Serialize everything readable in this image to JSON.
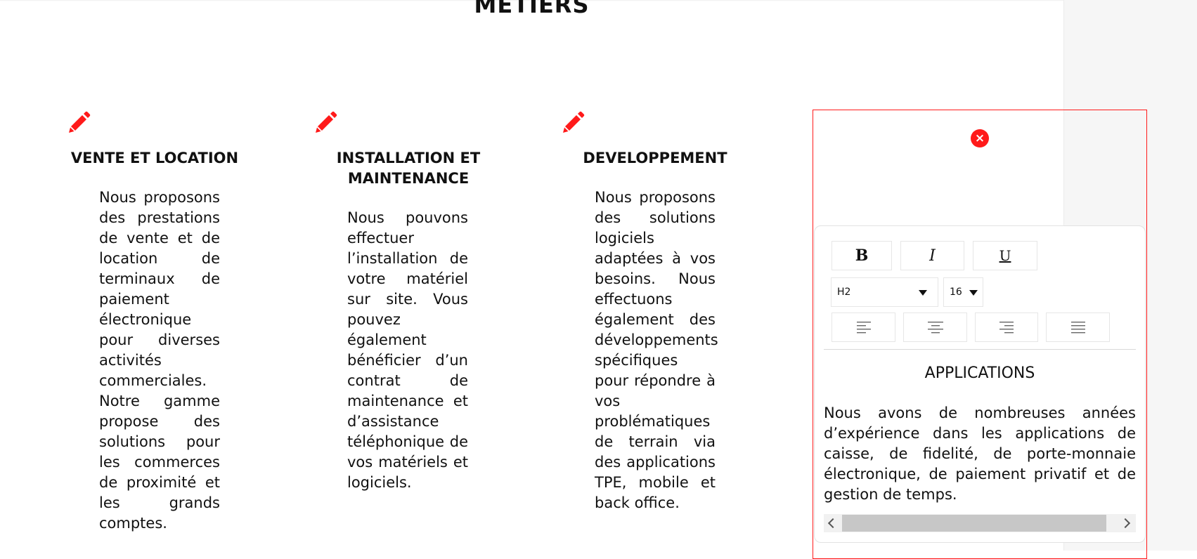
{
  "section": {
    "title": "METIERS"
  },
  "columns": [
    {
      "heading": "VENTE ET LOCATION",
      "text": "Nous proposons des prestations de vente et de location de terminaux de paiement électronique pour diverses activités commerciales. Notre gamme propose des solutions pour les commerces de proximité et les grands comptes."
    },
    {
      "heading": "INSTALLATION ET MAINTENANCE",
      "text": "Nous pouvons effectuer l’installation de votre matériel sur site. Vous pouvez également bénéficier d’un contrat de maintenance et d’assistance téléphonique de vos matériels et logiciels."
    },
    {
      "heading": "DEVELOPPEMENT",
      "text": "Nous proposons des solutions logiciels adaptées à vos besoins. Nous effectuons également des développements spécifiques pour répondre à vos problématiques de terrain via des applications TPE, mobile et back office."
    }
  ],
  "editor": {
    "close_symbol": "×",
    "toolbar": {
      "bold_label": "B",
      "italic_label": "I",
      "underline_label": "U",
      "heading_select": {
        "selected": "H2"
      },
      "size_select": {
        "selected": "16"
      }
    },
    "content": {
      "heading": "APPLICATIONS",
      "text": "Nous avons de nombreuses années d’expérience dans les applications de caisse, de fidelité, de porte-monnaie électronique, de paiement privatif et de gestion de temps."
    }
  },
  "colors": {
    "accent": "#ff1a1a",
    "text": "#111111",
    "border": "#e6e6e6"
  },
  "icons": {
    "edit": "pencil-icon",
    "close": "close-icon",
    "align": [
      "align-left-icon",
      "align-center-icon",
      "align-right-icon",
      "align-justify-icon"
    ]
  }
}
